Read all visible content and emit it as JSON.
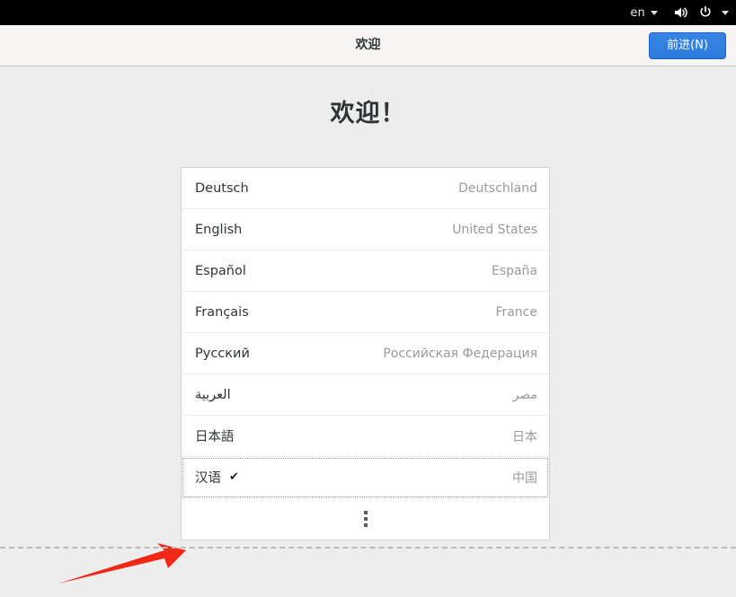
{
  "topbar": {
    "keyboard_label": "en",
    "keyboard_icon": "chevron-down-icon",
    "volume_icon": "speaker-icon",
    "power_icon": "power-icon",
    "menu_icon": "chevron-down-icon",
    "background": "#000000"
  },
  "header": {
    "title": "欢迎",
    "next_label": "前进(N)",
    "accent": "#3584e4"
  },
  "main": {
    "heading": "欢迎！"
  },
  "language_list": {
    "items": [
      {
        "language": "Deutsch",
        "country": "Deutschland",
        "selected": false
      },
      {
        "language": "English",
        "country": "United States",
        "selected": false
      },
      {
        "language": "Español",
        "country": "España",
        "selected": false
      },
      {
        "language": "Français",
        "country": "France",
        "selected": false
      },
      {
        "language": "Русский",
        "country": "Российская Федерация",
        "selected": false
      },
      {
        "language": "العربية",
        "country": "مصر",
        "selected": false
      },
      {
        "language": "日本語",
        "country": "日本",
        "selected": false
      },
      {
        "language": "汉语",
        "country": "中国",
        "selected": true
      }
    ],
    "selected_check": "✔",
    "more_icon": "vertical-ellipsis-icon"
  },
  "annotation": {
    "arrow_color": "#f42616"
  }
}
